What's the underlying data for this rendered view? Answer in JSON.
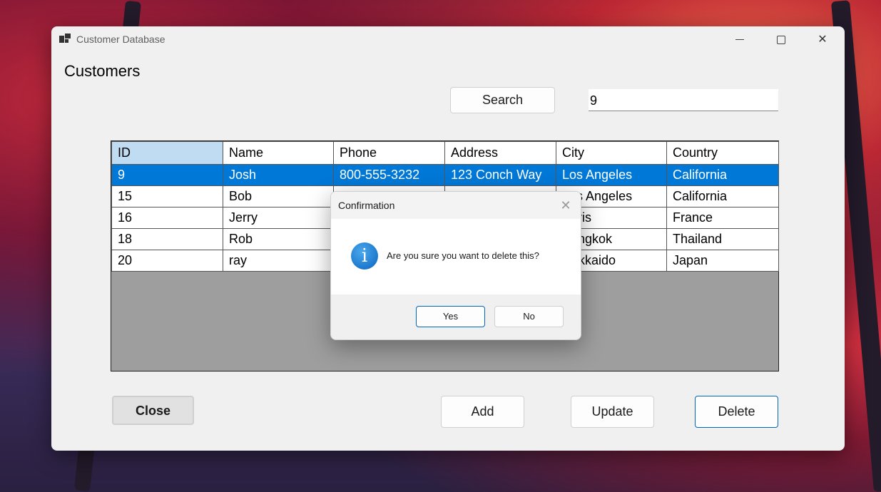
{
  "window": {
    "title": "Customer Database",
    "controls": {
      "minimize": "minimize-icon",
      "maximize": "maximize-icon",
      "close": "close-icon"
    }
  },
  "page": {
    "heading": "Customers"
  },
  "search": {
    "button_label": "Search",
    "value": "9"
  },
  "grid": {
    "columns": [
      "ID",
      "Name",
      "Phone",
      "Address",
      "City",
      "Country"
    ],
    "rows": [
      [
        "9",
        "Josh",
        "800-555-3232",
        "123 Conch Way",
        "Los Angeles",
        "California"
      ],
      [
        "15",
        "Bob",
        "",
        "",
        "Los Angeles",
        "California"
      ],
      [
        "16",
        "Jerry",
        "",
        "",
        "Paris",
        "France"
      ],
      [
        "18",
        "Rob",
        "",
        "",
        "Bangkok",
        "Thailand"
      ],
      [
        "20",
        "ray",
        "",
        "",
        "Hokkaido",
        "Japan"
      ]
    ],
    "selected_row": 0
  },
  "buttons": {
    "close": "Close",
    "add": "Add",
    "update": "Update",
    "delete": "Delete"
  },
  "dialog": {
    "title": "Confirmation",
    "icon": "info-icon",
    "message": "Are you sure you want to delete this?",
    "yes": "Yes",
    "no": "No"
  },
  "colors": {
    "selection": "#0078d7",
    "accent_border": "#0067c0",
    "sorted_header": "#c0dcf3"
  }
}
